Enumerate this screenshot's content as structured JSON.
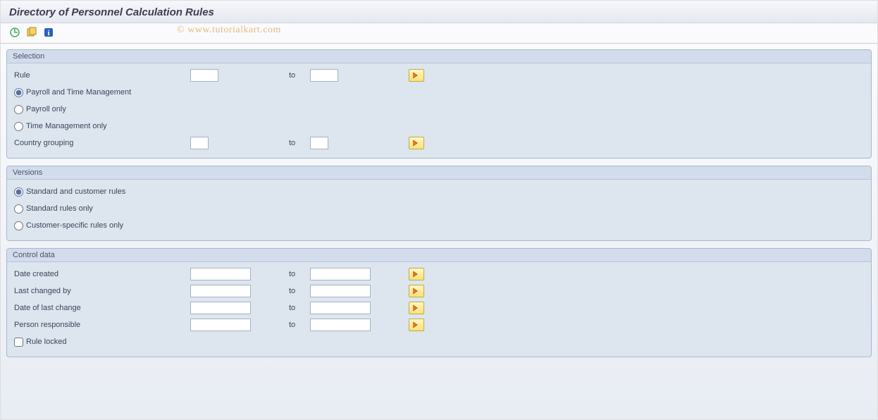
{
  "title": "Directory of Personnel Calculation Rules",
  "watermark": "© www.tutorialkart.com",
  "to_label": "to",
  "selection": {
    "title": "Selection",
    "rule_label": "Rule",
    "rule_from": "",
    "rule_to": "",
    "opt1": "Payroll and Time Management",
    "opt2": "Payroll only",
    "opt3": "Time Management only",
    "country_label": "Country grouping",
    "country_from": "",
    "country_to": ""
  },
  "versions": {
    "title": "Versions",
    "opt1": "Standard and customer rules",
    "opt2": "Standard rules only",
    "opt3": "Customer-specific rules only"
  },
  "control": {
    "title": "Control data",
    "date_created_label": "Date created",
    "date_created_from": "",
    "date_created_to": "",
    "last_changed_by_label": "Last changed by",
    "last_changed_by_from": "",
    "last_changed_by_to": "",
    "date_last_change_label": "Date of last change",
    "date_last_change_from": "",
    "date_last_change_to": "",
    "person_resp_label": "Person responsible",
    "person_resp_from": "",
    "person_resp_to": "",
    "rule_locked_label": "Rule locked"
  }
}
